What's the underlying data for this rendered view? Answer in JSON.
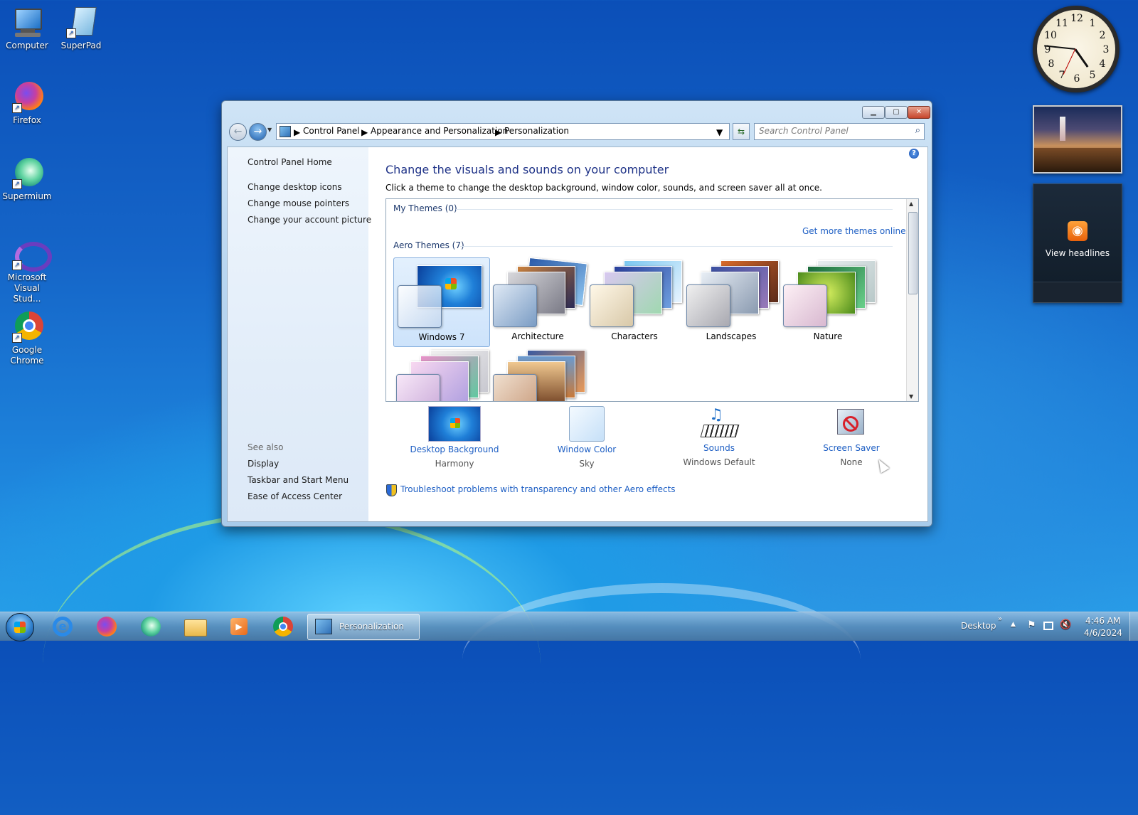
{
  "desktop": {
    "icons": [
      {
        "name": "Computer",
        "lines": [
          "Computer"
        ]
      },
      {
        "name": "SuperPad",
        "lines": [
          "SuperPad"
        ]
      },
      {
        "name": "Firefox",
        "lines": [
          "Firefox"
        ]
      },
      {
        "name": "Supermium",
        "lines": [
          "Supermium"
        ]
      },
      {
        "name": "Microsoft Visual Studio",
        "lines": [
          "Microsoft",
          "Visual Stud..."
        ]
      },
      {
        "name": "Google Chrome",
        "lines": [
          "Google",
          "Chrome"
        ]
      }
    ]
  },
  "gadgets": {
    "feed_label": "View headlines"
  },
  "window": {
    "breadcrumb": [
      "Control Panel",
      "Appearance and Personalization",
      "Personalization"
    ],
    "search_placeholder": "Search Control Panel",
    "sidebar": {
      "links": [
        "Control Panel Home",
        "Change desktop icons",
        "Change mouse pointers",
        "Change your account picture"
      ],
      "see_also_label": "See also",
      "see_also": [
        "Display",
        "Taskbar and Start Menu",
        "Ease of Access Center"
      ]
    },
    "main": {
      "title": "Change the visuals and sounds on your computer",
      "subtitle": "Click a theme to change the desktop background, window color, sounds, and screen saver all at once.",
      "my_themes_label": "My Themes (0)",
      "get_more": "Get more themes online",
      "aero_themes_label": "Aero Themes (7)",
      "themes": [
        "Windows 7",
        "Architecture",
        "Characters",
        "Landscapes",
        "Nature"
      ],
      "selected_theme": "Windows 7"
    },
    "bottom": [
      {
        "label": "Desktop Background",
        "value": "Harmony"
      },
      {
        "label": "Window Color",
        "value": "Sky"
      },
      {
        "label": "Sounds",
        "value": "Windows Default"
      },
      {
        "label": "Screen Saver",
        "value": "None"
      }
    ],
    "troubleshoot": "Troubleshoot problems with transparency and other Aero effects"
  },
  "taskbar": {
    "active_task": "Personalization",
    "desktop_label": "Desktop",
    "time": "4:46 AM",
    "date": "4/6/2024"
  },
  "colors": {
    "link": "#1e5fc4",
    "title": "#1e3287",
    "close_button": "#c7452c"
  }
}
